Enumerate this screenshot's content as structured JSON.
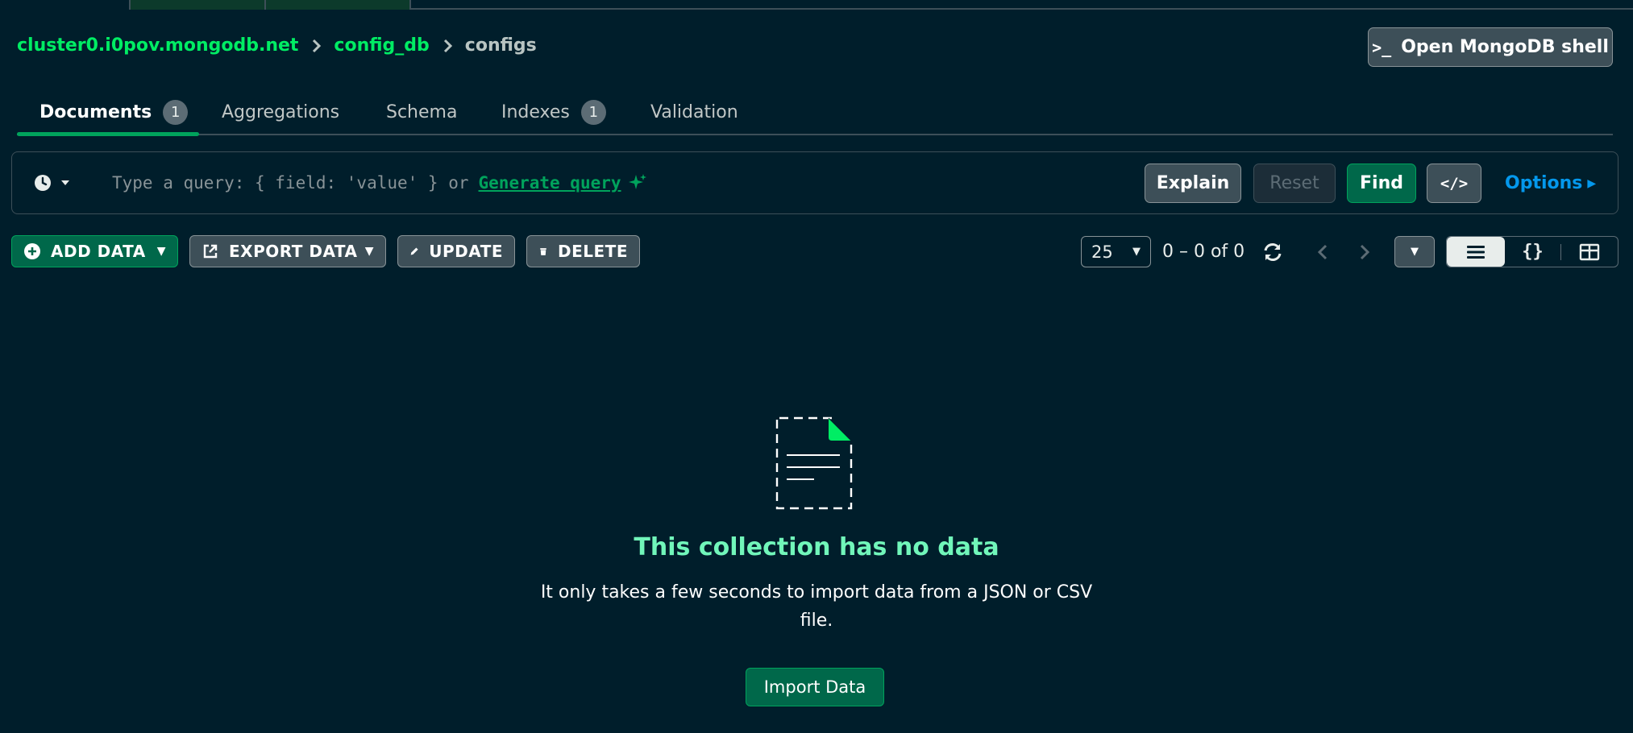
{
  "breadcrumb": {
    "cluster": "cluster0.i0pov.mongodb.net",
    "database": "config_db",
    "collection": "configs"
  },
  "shell_button": {
    "prompt": ">_",
    "label": "Open MongoDB shell"
  },
  "tabs": [
    {
      "label": "Documents",
      "count": "1",
      "active": true
    },
    {
      "label": "Aggregations"
    },
    {
      "label": "Schema"
    },
    {
      "label": "Indexes",
      "count": "1"
    },
    {
      "label": "Validation"
    }
  ],
  "query_bar": {
    "placeholder": "Type a query: { field: 'value' } or",
    "generate_link": "Generate query",
    "explain": "Explain",
    "reset": "Reset",
    "find": "Find",
    "code_toggle": "</>",
    "options": "Options"
  },
  "toolbar": {
    "add_data": "ADD DATA",
    "export_data": "EXPORT DATA",
    "update": "UPDATE",
    "delete": "DELETE",
    "page_size": "25",
    "page_range": "0 – 0 of 0",
    "json_view": "{}"
  },
  "empty_state": {
    "title": "This collection has no data",
    "description": "It only takes a few seconds to import data from a JSON or CSV file.",
    "import_button": "Import Data"
  },
  "colors": {
    "background": "#001e2b",
    "accent_green": "#00ed64",
    "button_green": "#00684a",
    "link_blue": "#0498ec",
    "title_green": "#71f6ba"
  },
  "icons": [
    "clock-icon",
    "sparkle-icon",
    "plus-circle-icon",
    "export-icon",
    "pencil-icon",
    "trash-icon",
    "refresh-icon",
    "chevron-left-icon",
    "chevron-right-icon",
    "list-view-icon",
    "table-view-icon",
    "document-icon"
  ]
}
